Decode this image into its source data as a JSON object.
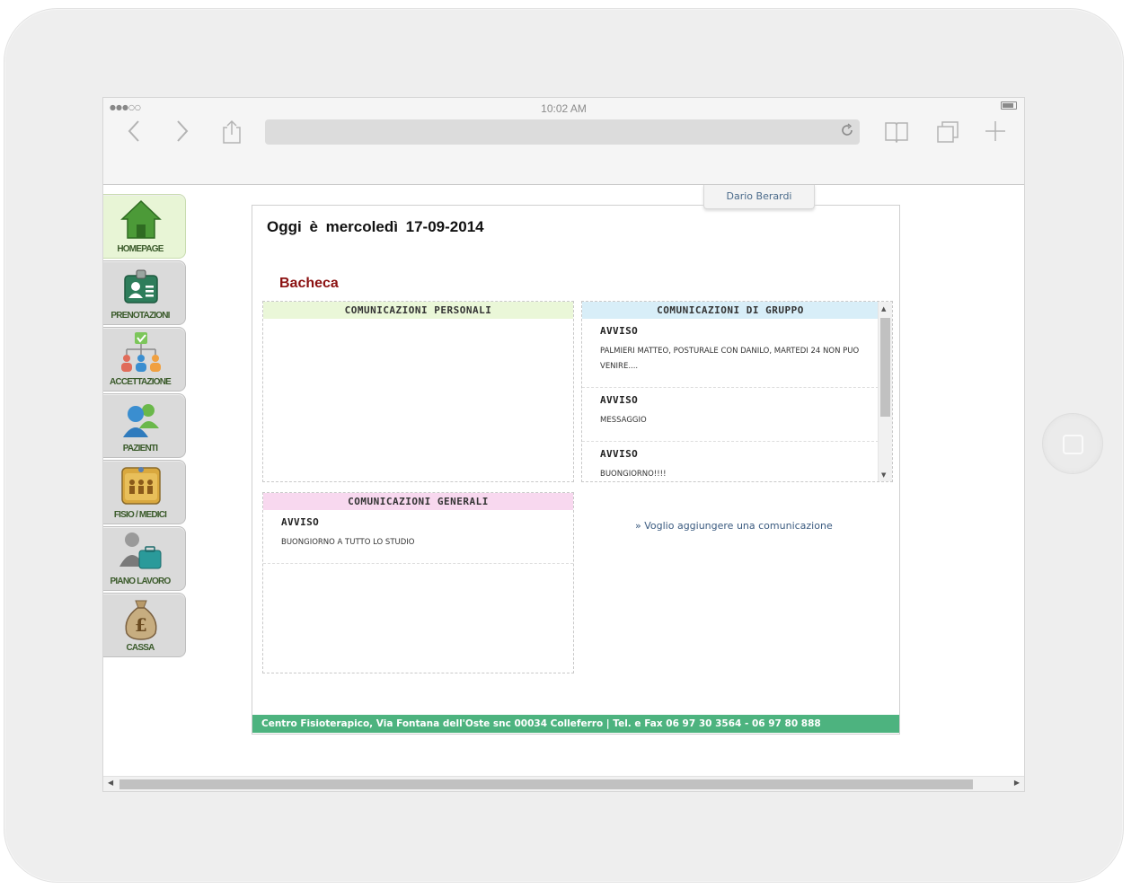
{
  "status_bar": {
    "signal": "●●●○○",
    "time": "10:02 AM"
  },
  "browser": {
    "back_icon": "chevron-left-icon",
    "forward_icon": "chevron-right-icon",
    "share_icon": "share-icon",
    "reload_icon": "reload-icon",
    "bookmarks_icon": "book-icon",
    "tabs_icon": "tabs-icon",
    "new_tab_icon": "plus-icon"
  },
  "user": {
    "name": "Dario Berardi"
  },
  "sidebar": {
    "items": [
      {
        "label": "HOMEPAGE",
        "icon": "home-icon",
        "active": true
      },
      {
        "label": "PRENOTAZIONI",
        "icon": "id-card-icon",
        "active": false
      },
      {
        "label": "ACCETTAZIONE",
        "icon": "org-chart-icon",
        "active": false
      },
      {
        "label": "PAZIENTI",
        "icon": "patients-icon",
        "active": false
      },
      {
        "label": "FISIO / MEDICI",
        "icon": "staff-folder-icon",
        "active": false
      },
      {
        "label": "PIANO LAVORO",
        "icon": "briefcase-icon",
        "active": false
      },
      {
        "label": "CASSA",
        "icon": "money-bag-icon",
        "active": false
      }
    ]
  },
  "main": {
    "date_title": "Oggi è mercoledì 17-09-2014",
    "board_title": "Bacheca",
    "personal": {
      "header": "COMUNICAZIONI PERSONALI",
      "color": "#eaf7d8"
    },
    "group": {
      "header": "COMUNICAZIONI DI GRUPPO",
      "color": "#d8eef8",
      "messages": [
        {
          "title": "AVVISO",
          "body": "Palmieri Matteo, posturale con Danilo, martedi 24 non puo venire...."
        },
        {
          "title": "AVVISO",
          "body": "MESSAGGIO"
        },
        {
          "title": "AVVISO",
          "body": "BUONGIORNO!!!!"
        }
      ]
    },
    "general": {
      "header": "COMUNICAZIONI GENERALI",
      "color": "#f8d8ef",
      "messages": [
        {
          "title": "AVVISO",
          "body": "BUONGIORNO A TUTTO LO STUDIO"
        }
      ]
    },
    "add_link": "» Voglio aggiungere una comunicazione",
    "footer": "Centro Fisioterapico, Via Fontana dell'Oste snc 00034 Colleferro | Tel. e Fax 06 97 30 3564 - 06 97 80 888"
  }
}
